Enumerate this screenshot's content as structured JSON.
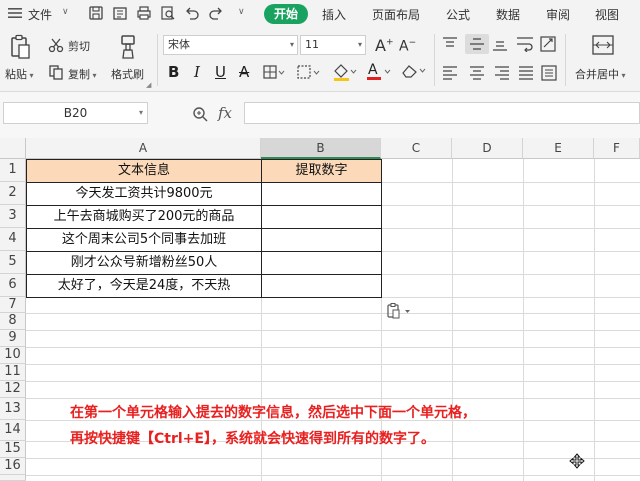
{
  "menu": {
    "file": "文件",
    "tabs": [
      "开始",
      "插入",
      "页面布局",
      "公式",
      "数据",
      "审阅",
      "视图"
    ]
  },
  "ribbon": {
    "paste": "粘贴",
    "cut": "剪切",
    "copy": "复制",
    "format_painter": "格式刷",
    "font_name": "宋体",
    "font_size": "11",
    "merge_center": "合并居中"
  },
  "formula_bar": {
    "name_box": "B20",
    "fx": "fx",
    "formula": ""
  },
  "columns": [
    "A",
    "B",
    "C",
    "D",
    "E",
    "F"
  ],
  "rows": [
    "1",
    "2",
    "3",
    "4",
    "5",
    "6",
    "7",
    "8",
    "9",
    "10",
    "11",
    "12",
    "13",
    "14",
    "15",
    "16"
  ],
  "table": {
    "header_a": "文本信息",
    "header_b": "提取数字",
    "col_a": [
      "今天发工资共计9800元",
      "上午去商城购买了200元的商品",
      "这个周末公司5个同事去加班",
      "刚才公众号新增粉丝50人",
      "太好了，今天是24度，不天热"
    ]
  },
  "instruction": {
    "line1": "在第一个单元格输入提去的数字信息，然后选中下面一个单元格，",
    "line2": "再按快捷键【Ctrl+E】，系统就会快速得到所有的数字了。"
  },
  "colors": {
    "accent": "#1aa260",
    "header_fill": "#fbd9b9",
    "note": "#e8201f",
    "selection": "#2e8b57"
  }
}
